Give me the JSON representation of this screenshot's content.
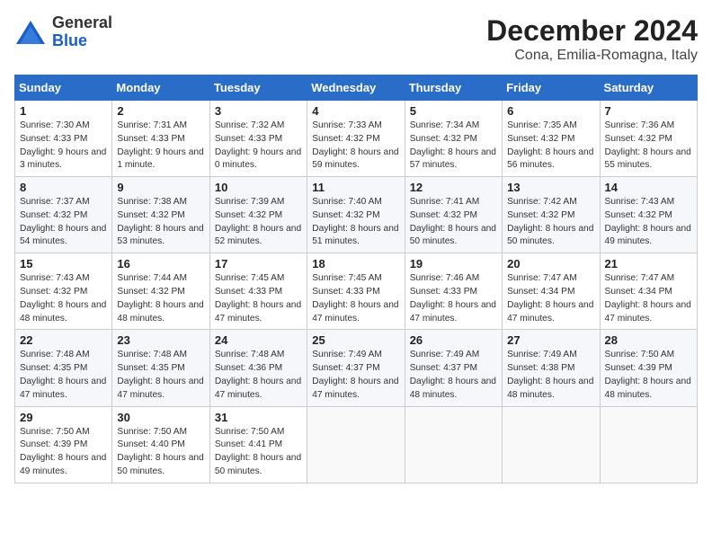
{
  "header": {
    "logo_general": "General",
    "logo_blue": "Blue",
    "title": "December 2024",
    "subtitle": "Cona, Emilia-Romagna, Italy"
  },
  "weekdays": [
    "Sunday",
    "Monday",
    "Tuesday",
    "Wednesday",
    "Thursday",
    "Friday",
    "Saturday"
  ],
  "weeks": [
    [
      {
        "day": "1",
        "info": "Sunrise: 7:30 AM\nSunset: 4:33 PM\nDaylight: 9 hours and 3 minutes."
      },
      {
        "day": "2",
        "info": "Sunrise: 7:31 AM\nSunset: 4:33 PM\nDaylight: 9 hours and 1 minute."
      },
      {
        "day": "3",
        "info": "Sunrise: 7:32 AM\nSunset: 4:33 PM\nDaylight: 9 hours and 0 minutes."
      },
      {
        "day": "4",
        "info": "Sunrise: 7:33 AM\nSunset: 4:32 PM\nDaylight: 8 hours and 59 minutes."
      },
      {
        "day": "5",
        "info": "Sunrise: 7:34 AM\nSunset: 4:32 PM\nDaylight: 8 hours and 57 minutes."
      },
      {
        "day": "6",
        "info": "Sunrise: 7:35 AM\nSunset: 4:32 PM\nDaylight: 8 hours and 56 minutes."
      },
      {
        "day": "7",
        "info": "Sunrise: 7:36 AM\nSunset: 4:32 PM\nDaylight: 8 hours and 55 minutes."
      }
    ],
    [
      {
        "day": "8",
        "info": "Sunrise: 7:37 AM\nSunset: 4:32 PM\nDaylight: 8 hours and 54 minutes."
      },
      {
        "day": "9",
        "info": "Sunrise: 7:38 AM\nSunset: 4:32 PM\nDaylight: 8 hours and 53 minutes."
      },
      {
        "day": "10",
        "info": "Sunrise: 7:39 AM\nSunset: 4:32 PM\nDaylight: 8 hours and 52 minutes."
      },
      {
        "day": "11",
        "info": "Sunrise: 7:40 AM\nSunset: 4:32 PM\nDaylight: 8 hours and 51 minutes."
      },
      {
        "day": "12",
        "info": "Sunrise: 7:41 AM\nSunset: 4:32 PM\nDaylight: 8 hours and 50 minutes."
      },
      {
        "day": "13",
        "info": "Sunrise: 7:42 AM\nSunset: 4:32 PM\nDaylight: 8 hours and 50 minutes."
      },
      {
        "day": "14",
        "info": "Sunrise: 7:43 AM\nSunset: 4:32 PM\nDaylight: 8 hours and 49 minutes."
      }
    ],
    [
      {
        "day": "15",
        "info": "Sunrise: 7:43 AM\nSunset: 4:32 PM\nDaylight: 8 hours and 48 minutes."
      },
      {
        "day": "16",
        "info": "Sunrise: 7:44 AM\nSunset: 4:32 PM\nDaylight: 8 hours and 48 minutes."
      },
      {
        "day": "17",
        "info": "Sunrise: 7:45 AM\nSunset: 4:33 PM\nDaylight: 8 hours and 47 minutes."
      },
      {
        "day": "18",
        "info": "Sunrise: 7:45 AM\nSunset: 4:33 PM\nDaylight: 8 hours and 47 minutes."
      },
      {
        "day": "19",
        "info": "Sunrise: 7:46 AM\nSunset: 4:33 PM\nDaylight: 8 hours and 47 minutes."
      },
      {
        "day": "20",
        "info": "Sunrise: 7:47 AM\nSunset: 4:34 PM\nDaylight: 8 hours and 47 minutes."
      },
      {
        "day": "21",
        "info": "Sunrise: 7:47 AM\nSunset: 4:34 PM\nDaylight: 8 hours and 47 minutes."
      }
    ],
    [
      {
        "day": "22",
        "info": "Sunrise: 7:48 AM\nSunset: 4:35 PM\nDaylight: 8 hours and 47 minutes."
      },
      {
        "day": "23",
        "info": "Sunrise: 7:48 AM\nSunset: 4:35 PM\nDaylight: 8 hours and 47 minutes."
      },
      {
        "day": "24",
        "info": "Sunrise: 7:48 AM\nSunset: 4:36 PM\nDaylight: 8 hours and 47 minutes."
      },
      {
        "day": "25",
        "info": "Sunrise: 7:49 AM\nSunset: 4:37 PM\nDaylight: 8 hours and 47 minutes."
      },
      {
        "day": "26",
        "info": "Sunrise: 7:49 AM\nSunset: 4:37 PM\nDaylight: 8 hours and 48 minutes."
      },
      {
        "day": "27",
        "info": "Sunrise: 7:49 AM\nSunset: 4:38 PM\nDaylight: 8 hours and 48 minutes."
      },
      {
        "day": "28",
        "info": "Sunrise: 7:50 AM\nSunset: 4:39 PM\nDaylight: 8 hours and 48 minutes."
      }
    ],
    [
      {
        "day": "29",
        "info": "Sunrise: 7:50 AM\nSunset: 4:39 PM\nDaylight: 8 hours and 49 minutes."
      },
      {
        "day": "30",
        "info": "Sunrise: 7:50 AM\nSunset: 4:40 PM\nDaylight: 8 hours and 50 minutes."
      },
      {
        "day": "31",
        "info": "Sunrise: 7:50 AM\nSunset: 4:41 PM\nDaylight: 8 hours and 50 minutes."
      },
      null,
      null,
      null,
      null
    ]
  ]
}
